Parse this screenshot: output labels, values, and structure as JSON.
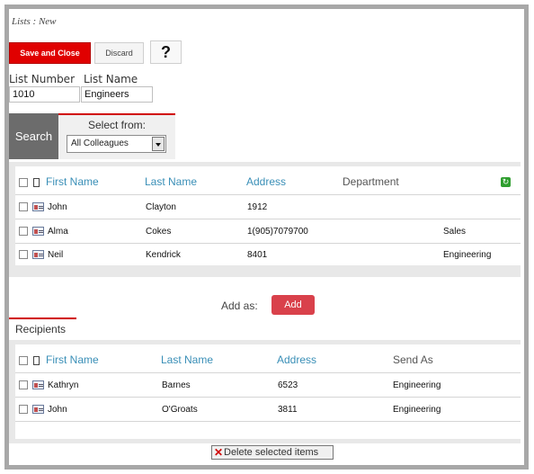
{
  "page": {
    "title": "Lists : New"
  },
  "toolbar": {
    "save_close_label": "Save and Close",
    "discard_label": "Discard",
    "help_label": "?"
  },
  "list": {
    "number_label": "List Number",
    "number_value": "1010",
    "name_label": "List Name",
    "name_value": "Engineers"
  },
  "search": {
    "tab_label": "Search",
    "select_label": "Select from:",
    "select_value": "All Colleagues"
  },
  "search_table": {
    "columns": [
      "First Name",
      "Last Name",
      "Address",
      "Department"
    ],
    "rows": [
      {
        "first": "John",
        "last": "Clayton",
        "address": "1912",
        "department": ""
      },
      {
        "first": "Alma",
        "last": "Cokes",
        "address": "1(905)7079700",
        "department": "Sales"
      },
      {
        "first": "Neil",
        "last": "Kendrick",
        "address": "8401",
        "department": "Engineering"
      }
    ]
  },
  "add": {
    "label": "Add as:",
    "button_label": "Add"
  },
  "recipients": {
    "tab_label": "Recipients",
    "columns": [
      "First Name",
      "Last Name",
      "Address",
      "Send As"
    ],
    "rows": [
      {
        "first": "Kathryn",
        "last": "Barnes",
        "address": "6523",
        "send_as": "Engineering"
      },
      {
        "first": "John",
        "last": "O'Groats",
        "address": "3811",
        "send_as": "Engineering"
      }
    ]
  },
  "footer": {
    "delete_label": "Delete selected items"
  },
  "colors": {
    "accent_red": "#e00000",
    "link_blue": "#3a8fb7",
    "add_button": "#d9414b"
  }
}
